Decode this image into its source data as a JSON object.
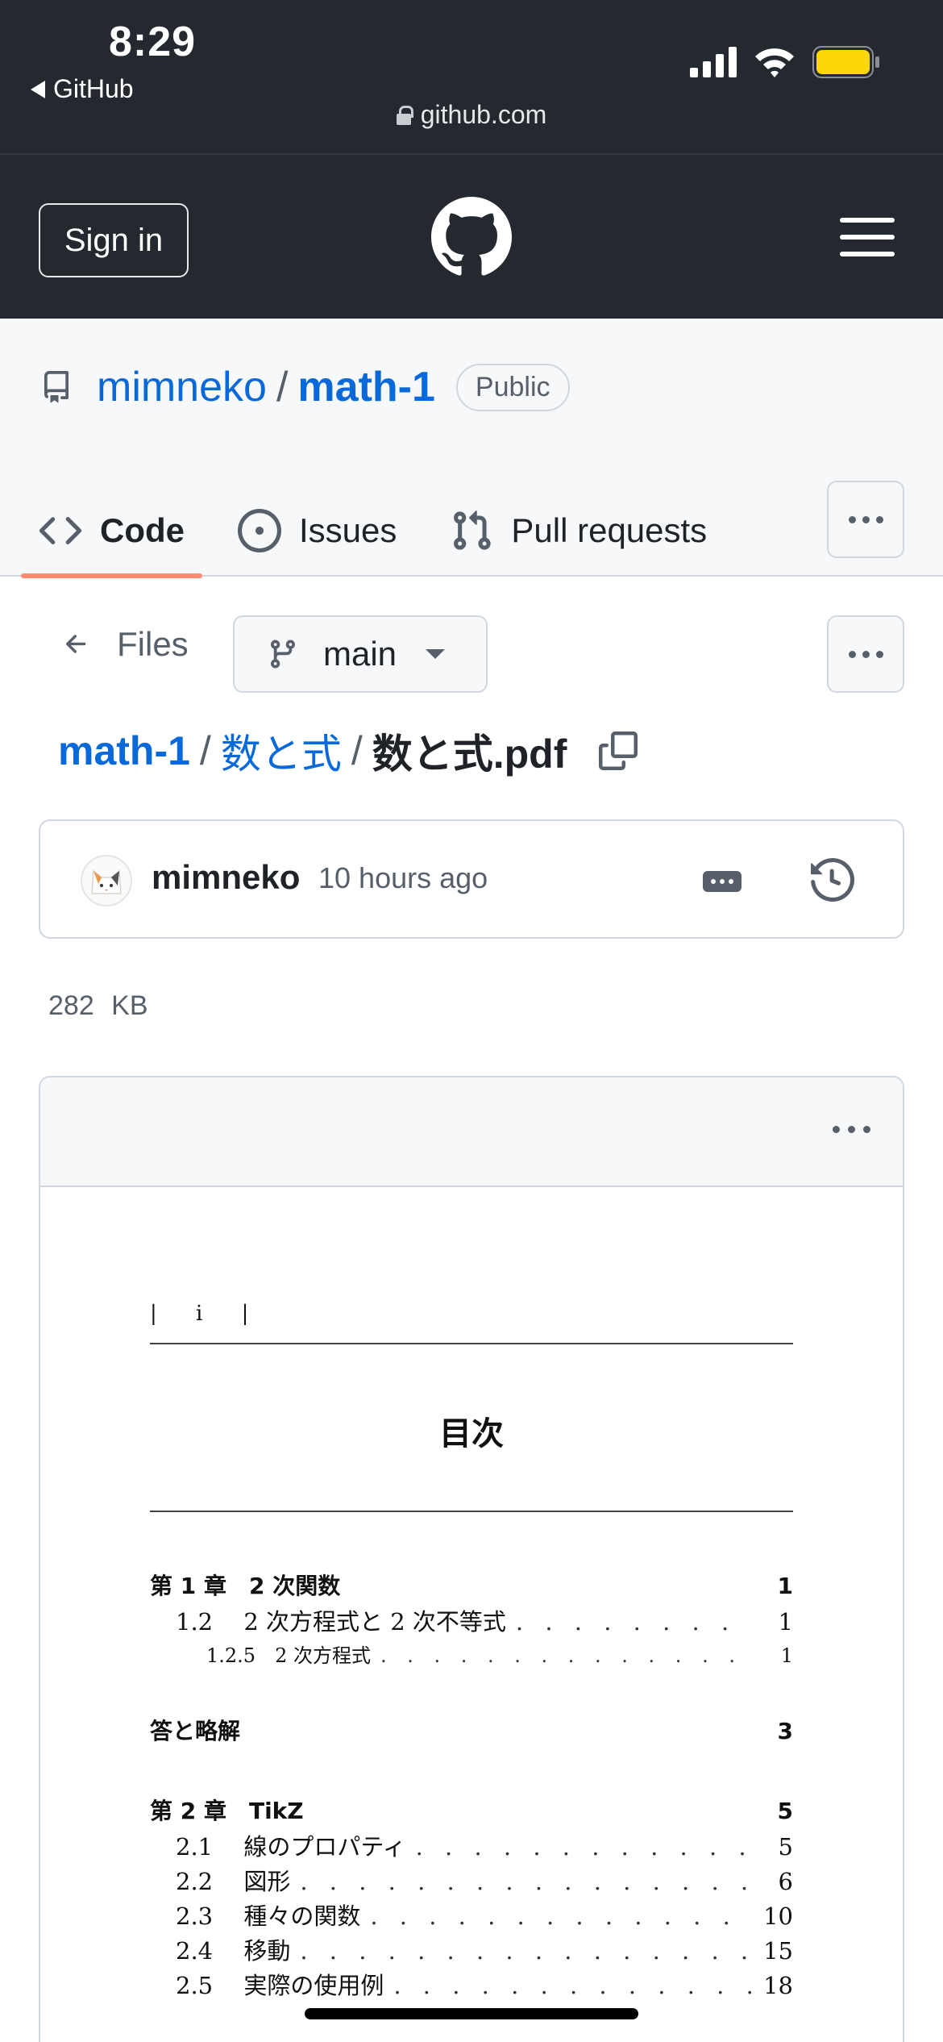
{
  "status_bar": {
    "time": "8:29",
    "back_app": "GitHub",
    "url": "github.com"
  },
  "header": {
    "sign_in": "Sign in"
  },
  "repo": {
    "owner": "mimneko",
    "separator": "/",
    "name": "math-1",
    "visibility": "Public"
  },
  "tabs": [
    {
      "label": "Code",
      "icon": "code-icon",
      "selected": true
    },
    {
      "label": "Issues",
      "icon": "issue-icon",
      "selected": false
    },
    {
      "label": "Pull requests",
      "icon": "pull-request-icon",
      "selected": false
    }
  ],
  "file_nav": {
    "files_label": "Files",
    "branch": "main"
  },
  "breadcrumb": {
    "root": "math-1",
    "dir": "数と式",
    "file": "数と式.pdf",
    "separator": "/"
  },
  "commit": {
    "author": "mimneko",
    "time": "10 hours ago"
  },
  "file_size": "282 KB",
  "pdf": {
    "page_number": "| i |",
    "toc_title": "目次",
    "entries": [
      {
        "label": "第 1 章　2 次関数",
        "page": "1",
        "level": "chapter"
      },
      {
        "label": "1.2　 2 次方程式と 2 次不等式",
        "page": "1",
        "level": "section"
      },
      {
        "label": "1.2.5　2 次方程式",
        "page": "1",
        "level": "subsection"
      },
      {
        "label": "答と略解",
        "page": "3",
        "level": "chapter"
      },
      {
        "label": "第 2 章　TikZ",
        "page": "5",
        "level": "chapter"
      },
      {
        "label": "2.1　 線のプロパティ",
        "page": "5",
        "level": "section"
      },
      {
        "label": "2.2　 図形",
        "page": "6",
        "level": "section"
      },
      {
        "label": "2.3　 種々の関数",
        "page": "10",
        "level": "section"
      },
      {
        "label": "2.4　 移動",
        "page": "15",
        "level": "section"
      },
      {
        "label": "2.5　 実際の使用例",
        "page": "18",
        "level": "section"
      }
    ]
  },
  "colors": {
    "header_bg": "#24292f",
    "link": "#0969da",
    "tab_underline": "#fd8c73",
    "battery": "#ffd60a"
  }
}
